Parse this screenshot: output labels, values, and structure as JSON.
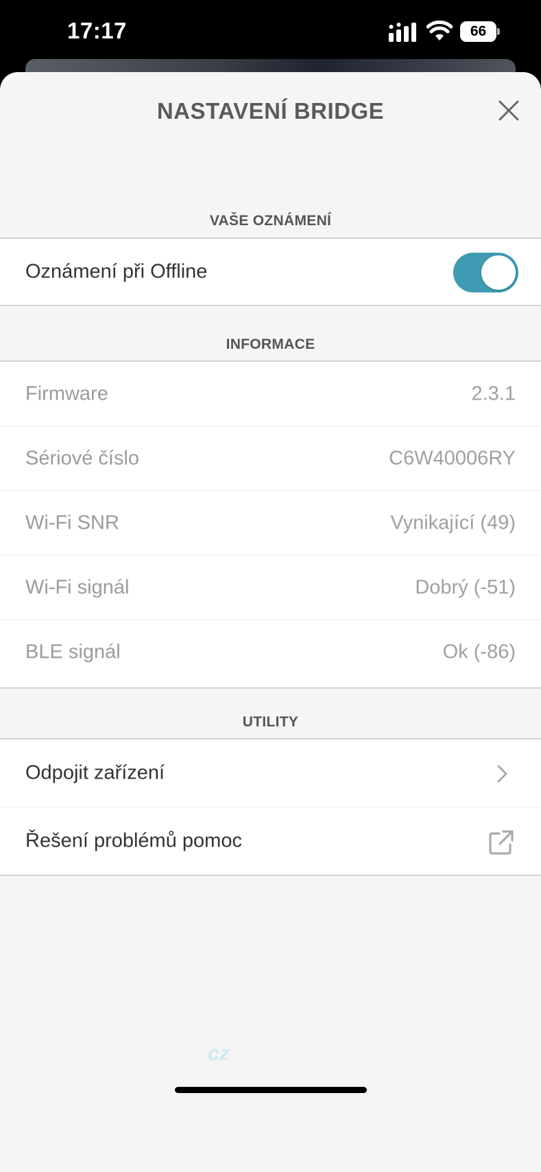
{
  "status_bar": {
    "time": "17:17",
    "battery": "66"
  },
  "header": {
    "title": "NASTAVENÍ BRIDGE"
  },
  "notifications": {
    "header": "VAŠE OZNÁMENÍ",
    "offline_label": "Oznámení při Offline",
    "offline_enabled": true
  },
  "info": {
    "header": "INFORMACE",
    "rows": [
      {
        "label": "Firmware",
        "value": "2.3.1"
      },
      {
        "label": "Sériové číslo",
        "value": "C6W40006RY"
      },
      {
        "label": "Wi-Fi SNR",
        "value": "Vynikající (49)"
      },
      {
        "label": "Wi-Fi signál",
        "value": "Dobrý (-51)"
      },
      {
        "label": "BLE signál",
        "value": "Ok (-86)"
      }
    ]
  },
  "utility": {
    "header": "UTILITY",
    "disconnect_label": "Odpojit zařízení",
    "troubleshoot_label": "Řešení problémů pomoc"
  },
  "watermark": {
    "tld": "cz"
  },
  "colors": {
    "accent": "#3e9bb3",
    "sheet": "#f5f5f5"
  }
}
